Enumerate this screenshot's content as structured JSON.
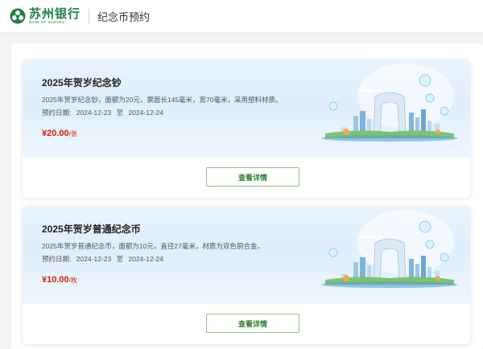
{
  "header": {
    "bank_name_cn": "苏州银行",
    "bank_name_en": "BANK OF SUZHOU",
    "page_title": "纪念币预约"
  },
  "colors": {
    "brand": "#1b7f43",
    "price": "#d81e06",
    "button_border": "#8fbf7f"
  },
  "cards": [
    {
      "title": "2025年贺岁纪念钞",
      "description": "2025年贺岁纪念钞，面额为20元，票面长145毫米，宽70毫米，采用塑料材质。",
      "date_label": "预约日期:",
      "date_start": "2024-12-23",
      "date_sep": "至",
      "date_end": "2024-12-24",
      "price": "¥20.00",
      "price_unit": "/张",
      "button_label": "查看详情"
    },
    {
      "title": "2025年贺岁普通纪念币",
      "description": "2025年贺岁普通纪念币，面额为10元，直径27毫米，材质为双色铜合金。",
      "date_label": "预约日期:",
      "date_start": "2024-12-23",
      "date_sep": "至",
      "date_end": "2024-12-24",
      "price": "¥10.00",
      "price_unit": "/枚",
      "button_label": "查看详情"
    }
  ]
}
